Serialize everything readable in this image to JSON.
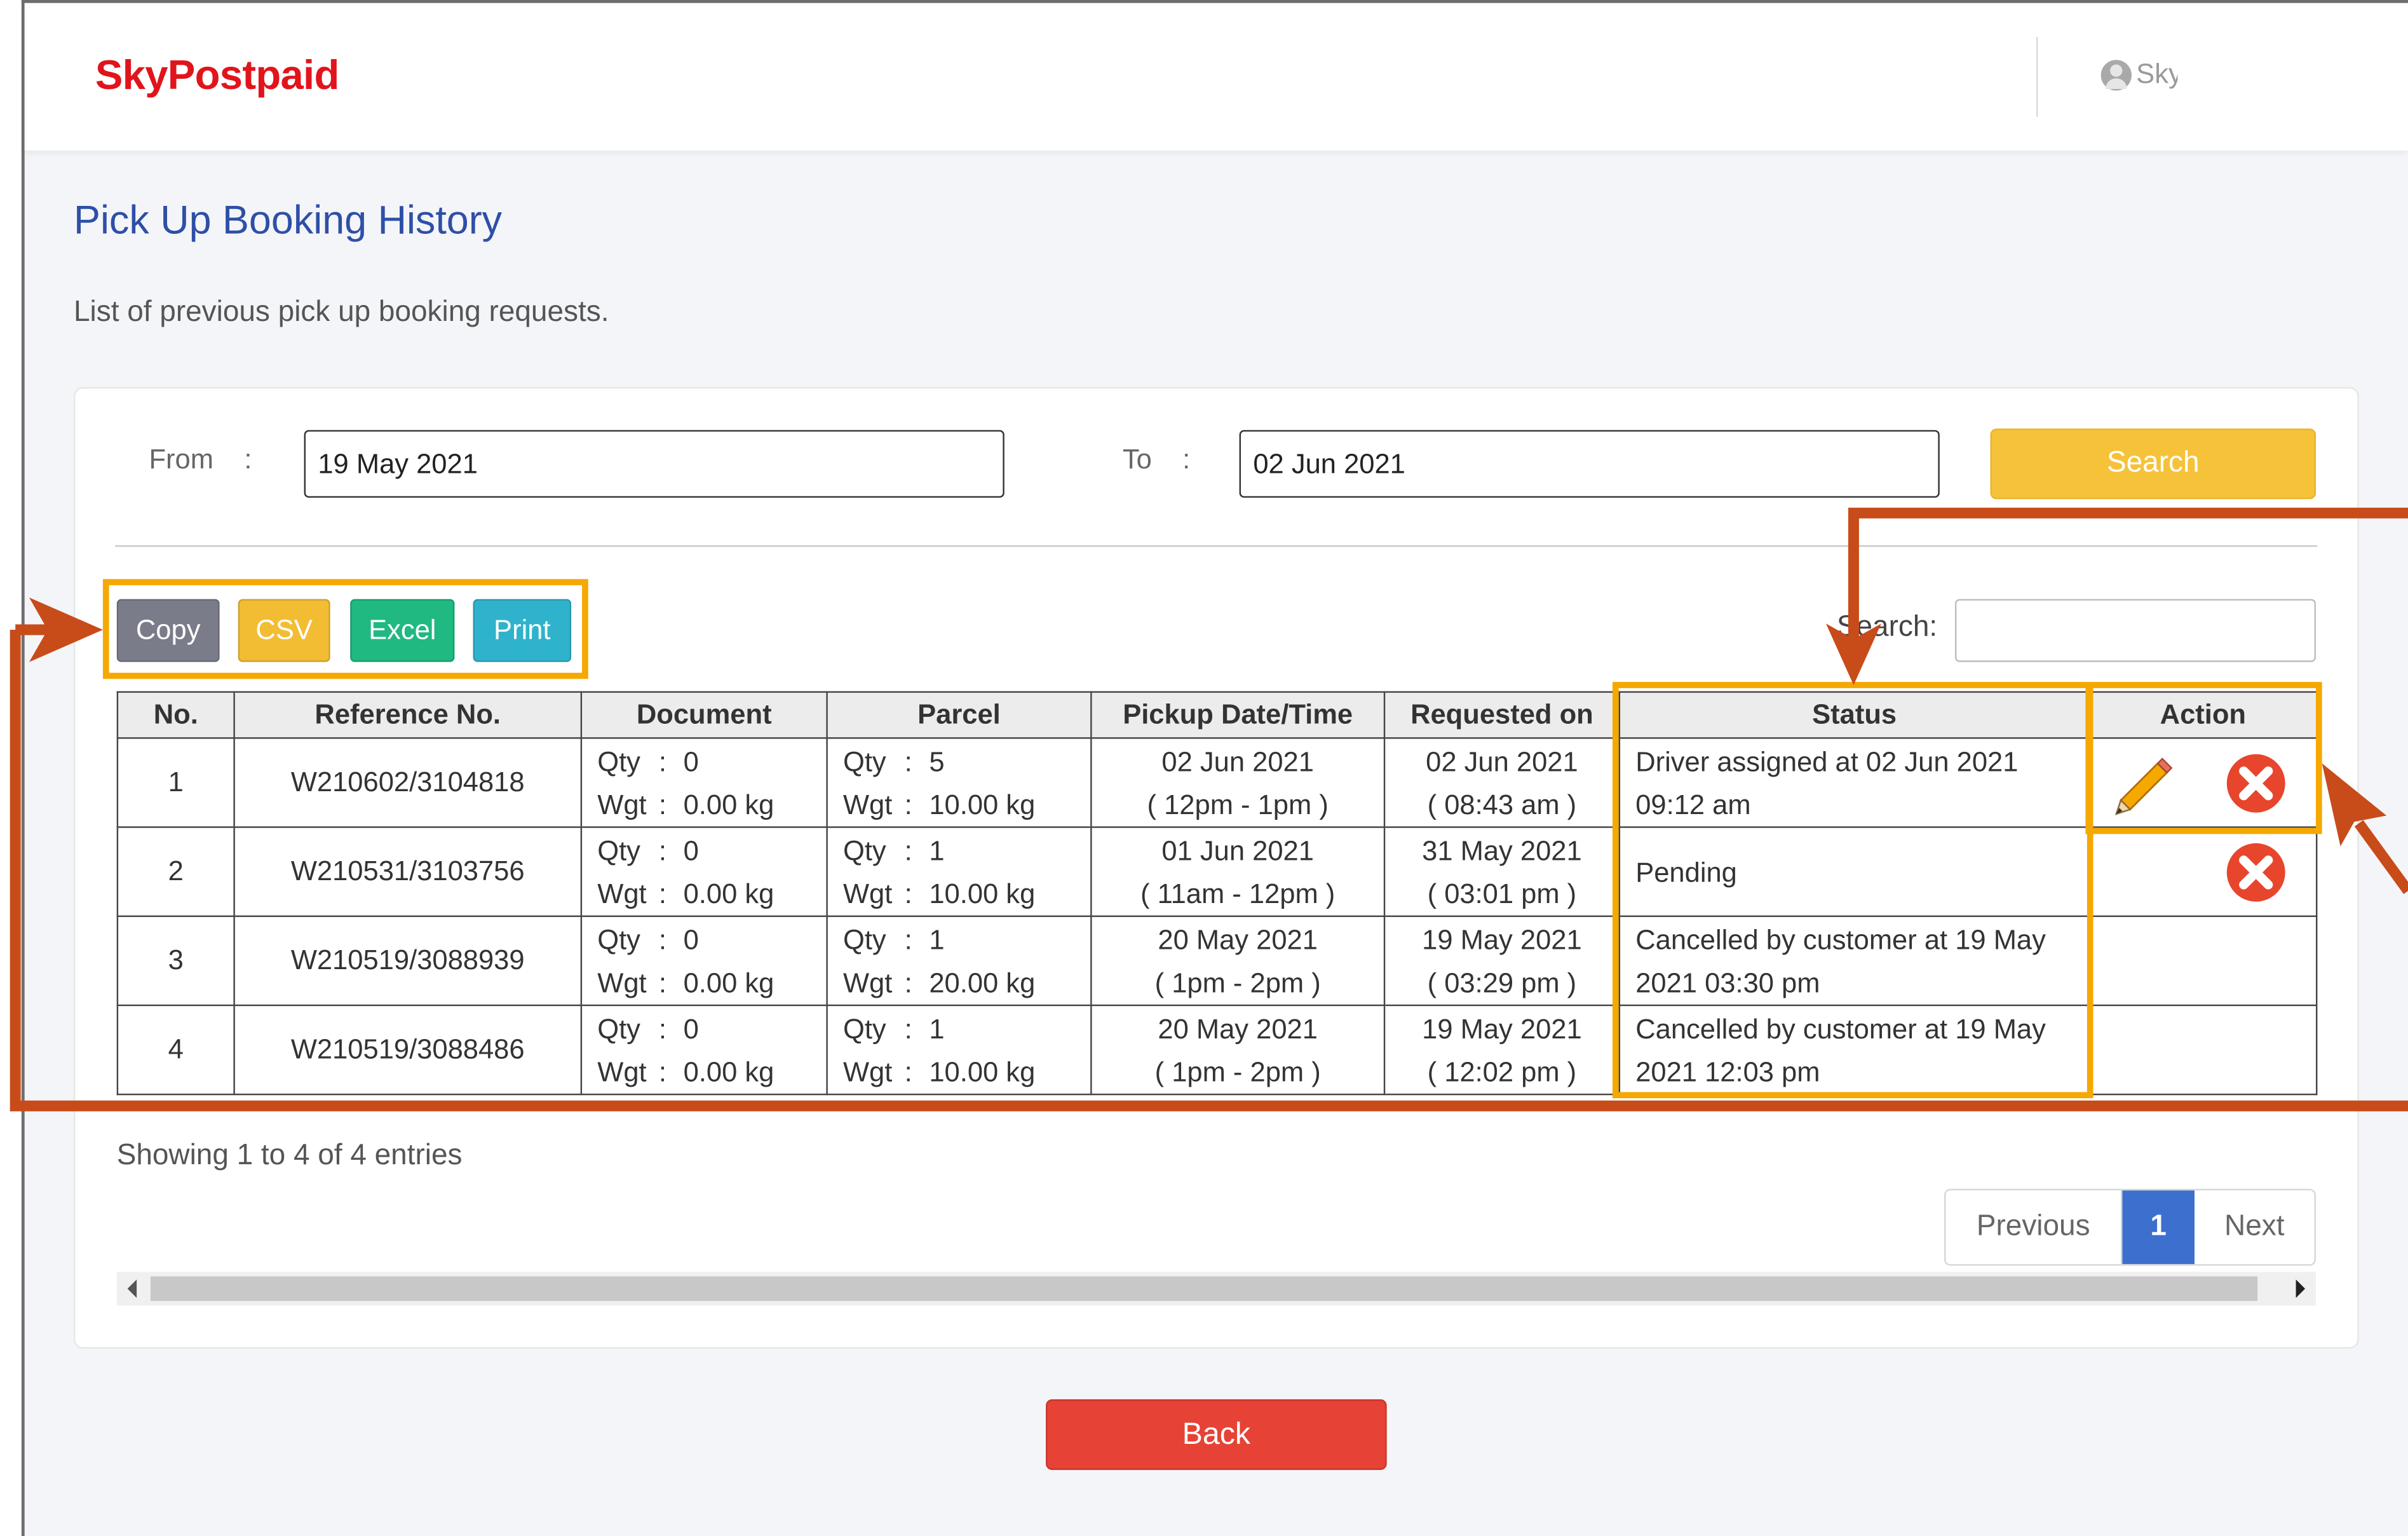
{
  "header": {
    "logo": "SkyPostpaid",
    "user_name": "Sky"
  },
  "page": {
    "title": "Pick Up Booking History",
    "subtitle": "List of previous pick up booking requests."
  },
  "filters": {
    "from_label": "From",
    "to_label": "To",
    "colon": ":",
    "from_value": "19 May 2021",
    "to_value": "02 Jun 2021",
    "search_button": "Search"
  },
  "export_buttons": [
    {
      "label": "Copy",
      "color": "#7a7c8a"
    },
    {
      "label": "CSV",
      "color": "#f3bd33"
    },
    {
      "label": "Excel",
      "color": "#1fb981"
    },
    {
      "label": "Print",
      "color": "#2fb3cc"
    }
  ],
  "table_search_label": "Search:",
  "table": {
    "columns": [
      "No.",
      "Reference No.",
      "Document",
      "Parcel",
      "Pickup Date/Time",
      "Requested on",
      "Status",
      "Action"
    ],
    "qty_label": "Qty",
    "wgt_label": "Wgt",
    "rows": [
      {
        "no": "1",
        "ref": "W210602/3104818",
        "doc_qty": "0",
        "doc_wgt": "0.00 kg",
        "par_qty": "5",
        "par_wgt": "10.00 kg",
        "pickup_date": "02 Jun 2021",
        "pickup_time": "( 12pm - 1pm )",
        "req_date": "02 Jun 2021",
        "req_time": "( 08:43 am )",
        "status": "Driver assigned at 02 Jun 2021 09:12 am"
      },
      {
        "no": "2",
        "ref": "W210531/3103756",
        "doc_qty": "0",
        "doc_wgt": "0.00 kg",
        "par_qty": "1",
        "par_wgt": "10.00 kg",
        "pickup_date": "01 Jun 2021",
        "pickup_time": "( 11am - 12pm )",
        "req_date": "31 May 2021",
        "req_time": "( 03:01 pm )",
        "status": "Pending"
      },
      {
        "no": "3",
        "ref": "W210519/3088939",
        "doc_qty": "0",
        "doc_wgt": "0.00 kg",
        "par_qty": "1",
        "par_wgt": "20.00 kg",
        "pickup_date": "20 May 2021",
        "pickup_time": "( 1pm - 2pm )",
        "req_date": "19 May 2021",
        "req_time": "( 03:29 pm )",
        "status": "Cancelled by customer at 19 May 2021 03:30 pm"
      },
      {
        "no": "4",
        "ref": "W210519/3088486",
        "doc_qty": "0",
        "doc_wgt": "0.00 kg",
        "par_qty": "1",
        "par_wgt": "10.00 kg",
        "pickup_date": "20 May 2021",
        "pickup_time": "( 1pm - 2pm )",
        "req_date": "19 May 2021",
        "req_time": "( 12:02 pm )",
        "status": "Cancelled by customer at 19 May 2021 12:03 pm"
      }
    ]
  },
  "info_text": "Showing 1 to 4 of 4 entries",
  "pagination": {
    "previous": "Previous",
    "current": "1",
    "next": "Next"
  },
  "back_button": "Back",
  "colors": {
    "brand": "#e1141c",
    "title": "#2e4fa7",
    "highlight": "#f5a800",
    "arrow": "#c84b1a"
  },
  "icons": [
    "user-icon",
    "pencil-icon",
    "close-circle-icon",
    "scroll-left-icon",
    "scroll-right-icon"
  ]
}
